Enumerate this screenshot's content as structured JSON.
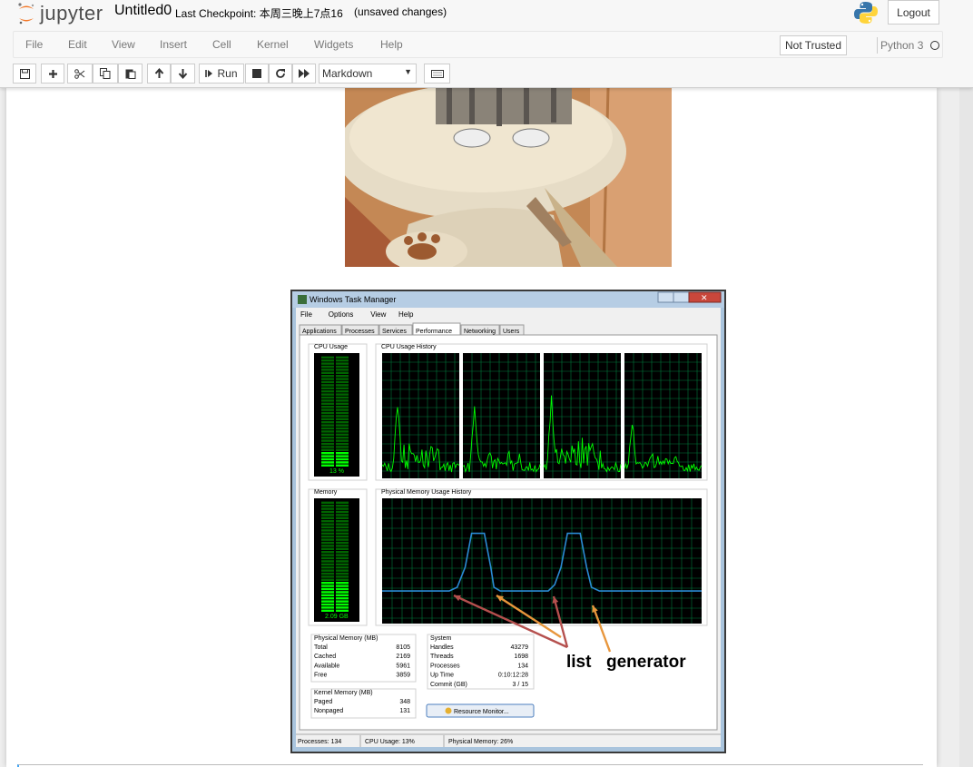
{
  "header": {
    "logo_text": "jupyter",
    "notebook_name": "Untitled0",
    "checkpoint": "Last Checkpoint: 本周三晚上7点16",
    "autosave": "(unsaved changes)",
    "logout": "Logout"
  },
  "menubar": {
    "items": [
      "File",
      "Edit",
      "View",
      "Insert",
      "Cell",
      "Kernel",
      "Widgets",
      "Help"
    ],
    "trusted": "Not Trusted",
    "kernel": "Python 3"
  },
  "toolbar": {
    "run_label": "Run",
    "cell_type": "Markdown"
  },
  "taskmanager": {
    "title": "Windows Task Manager",
    "menu": [
      "File",
      "Options",
      "View",
      "Help"
    ],
    "tabs": [
      "Applications",
      "Processes",
      "Services",
      "Performance",
      "Networking",
      "Users"
    ],
    "active_tab": "Performance",
    "cpu_usage_label": "CPU Usage",
    "cpu_usage_value": "13 %",
    "cpu_history_label": "CPU Usage History",
    "memory_label": "Memory",
    "memory_value": "2.09 GB",
    "mem_history_label": "Physical Memory Usage History",
    "physical_memory": {
      "title": "Physical Memory (MB)",
      "rows": [
        [
          "Total",
          "8105"
        ],
        [
          "Cached",
          "2169"
        ],
        [
          "Available",
          "5961"
        ],
        [
          "Free",
          "3859"
        ]
      ]
    },
    "kernel_memory": {
      "title": "Kernel Memory (MB)",
      "rows": [
        [
          "Paged",
          "348"
        ],
        [
          "Nonpaged",
          "131"
        ]
      ]
    },
    "system": {
      "title": "System",
      "rows": [
        [
          "Handles",
          "43279"
        ],
        [
          "Threads",
          "1698"
        ],
        [
          "Processes",
          "134"
        ],
        [
          "Up Time",
          "0:10:12:28"
        ],
        [
          "Commit (GB)",
          "3 / 15"
        ]
      ]
    },
    "resource_monitor": "Resource Monitor...",
    "status": [
      "Processes: 134",
      "CPU Usage: 13%",
      "Physical Memory: 26%"
    ],
    "annotations": {
      "list": "list",
      "generator": "generator"
    },
    "colors": {
      "list_arrow": "#b5504e",
      "generator_arrow": "#e8963c",
      "graph_green": "#00ff00",
      "memory_line": "#2a8ad4"
    }
  }
}
